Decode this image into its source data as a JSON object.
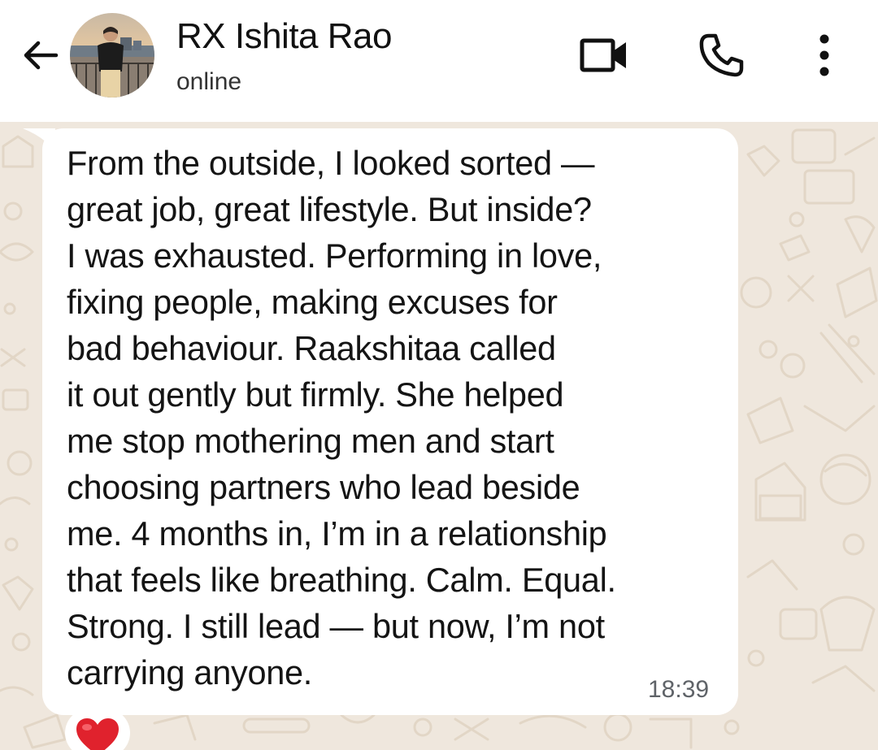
{
  "header": {
    "back_icon": "arrow-left-icon",
    "contact_name": "RX Ishita Rao",
    "status": "online",
    "video_icon": "video-camera-icon",
    "call_icon": "phone-icon",
    "menu_icon": "more-vertical-icon"
  },
  "message": {
    "text": "From the outside, I looked sorted —\ngreat job, great lifestyle. But inside?\nI was exhausted. Performing in love,\nfixing people, making excuses for\nbad behaviour. Raakshitaa called\nit out gently but firmly. She helped\nme stop mothering men and start\nchoosing partners who lead beside\nme. 4 months in, I’m in a relationship\nthat feels like breathing. Calm. Equal.\nStrong. I still lead — but now, I’m not\ncarrying anyone.",
    "time": "18:39",
    "reaction": "heart-emoji"
  },
  "colors": {
    "header_bg": "#ffffff",
    "chat_bg": "#efe7dd",
    "bubble_bg": "#ffffff",
    "text": "#141414",
    "time": "#5f6368",
    "reaction_heart": "#e0222d"
  }
}
